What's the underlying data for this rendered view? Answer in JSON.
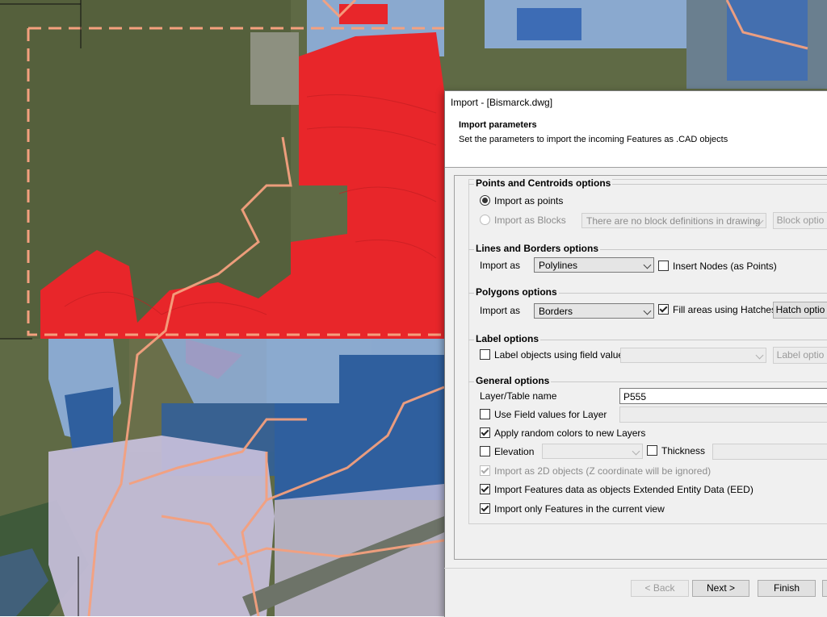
{
  "dialog": {
    "title": "Import - [Bismarck.dwg]",
    "header_title": "Import parameters",
    "header_subtitle": "Set the parameters to import the incoming Features as .CAD objects"
  },
  "points": {
    "title": "Points and Centroids options",
    "import_as_points": "Import as points",
    "import_as_blocks": "Import as Blocks",
    "block_combo": "There are no block definitions in drawing",
    "block_options_button": "Block optio"
  },
  "lines": {
    "title": "Lines and Borders options",
    "import_as_label": "Import as",
    "import_as_value": "Polylines",
    "insert_nodes": "Insert Nodes (as Points)"
  },
  "polygons": {
    "title": "Polygons options",
    "import_as_label": "Import as",
    "import_as_value": "Borders",
    "fill_areas": "Fill areas using Hatches",
    "hatch_options_button": "Hatch optio"
  },
  "labels": {
    "title": "Label options",
    "label_objects": "Label objects using field value",
    "label_options_button": "Label optio"
  },
  "general": {
    "title": "General options",
    "layer_name_label": "Layer/Table name",
    "layer_name_value": "P555",
    "use_field_values": "Use Field values for Layer",
    "random_colors": "Apply random colors to new Layers",
    "elevation": "Elevation",
    "thickness": "Thickness",
    "import_2d": "Import as 2D objects (Z coordinate will be ignored)",
    "import_eed": "Import Features data as objects Extended Entity Data (EED)",
    "import_current_view": "Import only Features in the current view"
  },
  "footer": {
    "back": "< Back",
    "next": "Next >",
    "finish": "Finish"
  },
  "colors": {
    "highlight": "#f5f200",
    "red_parcels": "#e8262a",
    "blue_parcels": "#2f5f9e",
    "light_blue_parcels": "#8fb0de",
    "lavender_parcels": "#c8c0dc",
    "trail_lines": "#f4a07e"
  }
}
